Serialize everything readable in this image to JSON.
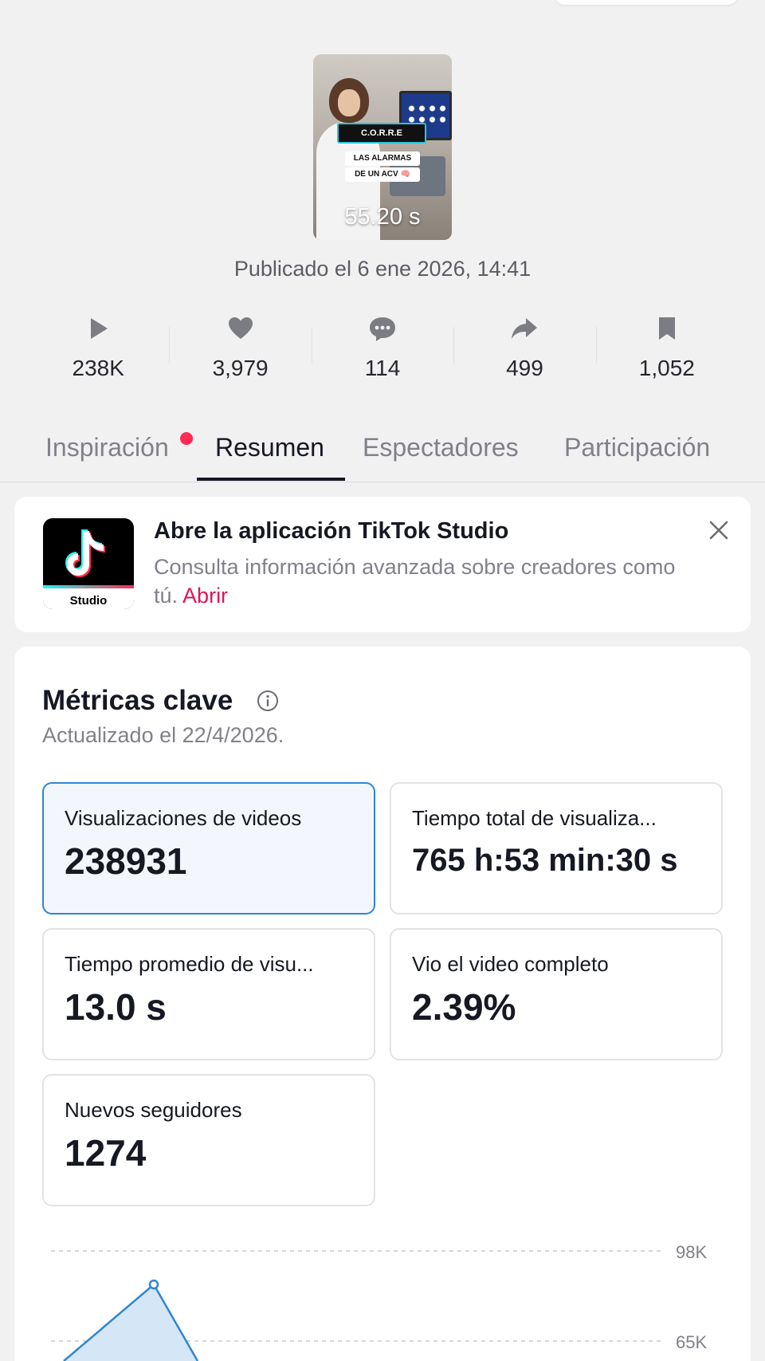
{
  "video": {
    "thumbnail_text_1": "C.O.R.R.E",
    "thumbnail_text_2": "LAS ALARMAS",
    "thumbnail_text_3": "DE UN ACV 🧠",
    "duration": "55.20 s",
    "published": "Publicado el 6 ene 2026, 14:41"
  },
  "stats": [
    {
      "icon": "play-icon",
      "value": "238K"
    },
    {
      "icon": "heart-icon",
      "value": "3,979"
    },
    {
      "icon": "comment-icon",
      "value": "114"
    },
    {
      "icon": "share-icon",
      "value": "499"
    },
    {
      "icon": "bookmark-icon",
      "value": "1,052"
    }
  ],
  "tabs": [
    {
      "label": "Inspiración",
      "has_dot": true
    },
    {
      "label": "Resumen",
      "active": true
    },
    {
      "label": "Espectadores"
    },
    {
      "label": "Participación"
    }
  ],
  "banner": {
    "logo_text": "Studio",
    "title": "Abre la aplicación TikTok Studio",
    "description": "Consulta información avanzada sobre creadores como tú.",
    "open_link": "Abrir"
  },
  "metrics": {
    "title": "Métricas clave",
    "updated": "Actualizado el 22/4/2026.",
    "cards": [
      {
        "label": "Visualizaciones de videos",
        "value": "238931",
        "selected": true
      },
      {
        "label": "Tiempo total de visualiza...",
        "value": "765 h:53 min:30 s"
      },
      {
        "label": "Tiempo promedio de visu...",
        "value": "13.0 s"
      },
      {
        "label": "Vio el video completo",
        "value": "2.39%"
      },
      {
        "label": "Nuevos seguidores",
        "value": "1274"
      }
    ]
  },
  "chart_data": {
    "type": "area",
    "y_ticks": [
      "98K",
      "65K"
    ],
    "color": "#2e86d4",
    "fill": "#cfe3f6"
  }
}
